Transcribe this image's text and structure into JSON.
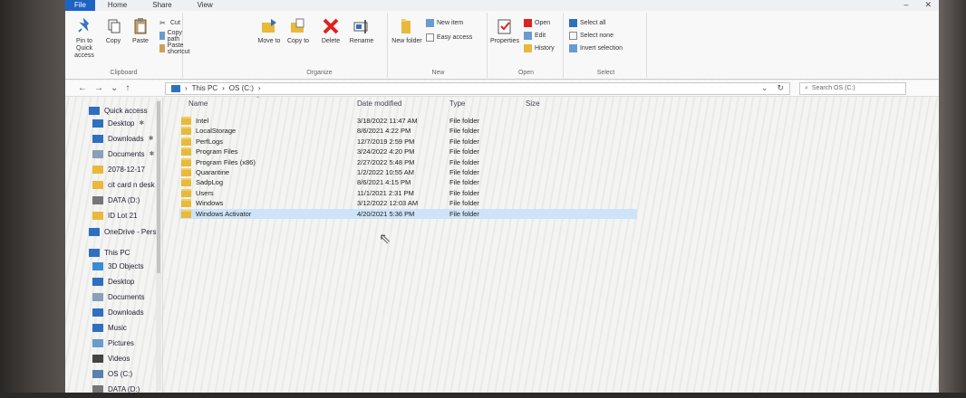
{
  "ribbon_tabs": [
    "File",
    "Home",
    "Share",
    "View"
  ],
  "window_controls": [
    "–",
    "✕"
  ],
  "clipboard": {
    "pin_label": "Pin to Quick access",
    "copy_label": "Copy",
    "paste_label": "Paste",
    "cut_label": "Cut",
    "copy_path_label": "Copy path",
    "paste_shortcut_label": "Paste shortcut",
    "group_label": "Clipboard"
  },
  "organize": {
    "move_to_label": "Move to",
    "copy_to_label": "Copy to",
    "delete_label": "Delete",
    "rename_label": "Rename",
    "group_label": "Organize"
  },
  "new": {
    "new_folder_label": "New folder",
    "new_item_label": "New item",
    "easy_access_label": "Easy access",
    "group_label": "New"
  },
  "open": {
    "properties_label": "Properties",
    "open_label": "Open",
    "edit_label": "Edit",
    "history_label": "History",
    "group_label": "Open"
  },
  "select": {
    "select_all_label": "Select all",
    "select_none_label": "Select none",
    "invert_label": "Invert selection",
    "group_label": "Select"
  },
  "address": {
    "segments": [
      "This PC",
      "OS (C:)"
    ],
    "search_placeholder": "Search OS (C:)"
  },
  "nav_pane": {
    "quick_access_label": "Quick access",
    "items": [
      {
        "label": "Desktop",
        "pinned": true,
        "icon": "desktop-icon",
        "color": "#2f6fc0"
      },
      {
        "label": "Downloads",
        "pinned": true,
        "icon": "download-icon",
        "color": "#2f6fc0"
      },
      {
        "label": "Documents",
        "pinned": true,
        "icon": "document-icon",
        "color": "#8aa0b8"
      },
      {
        "label": "2078-12-17",
        "pinned": false,
        "icon": "folder-icon",
        "color": "#e8b93a"
      },
      {
        "label": "cit card n desk",
        "pinned": false,
        "icon": "folder-icon",
        "color": "#e8b93a"
      },
      {
        "label": "DATA (D:)",
        "pinned": false,
        "icon": "drive-icon",
        "color": "#777777"
      },
      {
        "label": "ID Lot 21",
        "pinned": false,
        "icon": "folder-icon",
        "color": "#e8b93a"
      }
    ],
    "onedrive_label": "OneDrive - Pers",
    "this_pc_label": "This PC",
    "pc_items": [
      {
        "label": "3D Objects",
        "icon": "3d-objects-icon",
        "color": "#3a8ad6"
      },
      {
        "label": "Desktop",
        "icon": "desktop-icon",
        "color": "#2f6fc0"
      },
      {
        "label": "Documents",
        "icon": "document-icon",
        "color": "#8aa0b8"
      },
      {
        "label": "Downloads",
        "icon": "download-icon",
        "color": "#2f6fc0"
      },
      {
        "label": "Music",
        "icon": "music-icon",
        "color": "#2f6fc0"
      },
      {
        "label": "Pictures",
        "icon": "pictures-icon",
        "color": "#6a9bd0"
      },
      {
        "label": "Videos",
        "icon": "videos-icon",
        "color": "#444444"
      },
      {
        "label": "OS (C:)",
        "icon": "drive-icon",
        "color": "#5a7fb0"
      },
      {
        "label": "DATA (D:)",
        "icon": "drive-icon",
        "color": "#777777"
      }
    ]
  },
  "columns": {
    "name": "Name",
    "date": "Date modified",
    "type": "Type",
    "size": "Size"
  },
  "files": [
    {
      "name": "Intel",
      "date": "3/18/2022 11:47 AM",
      "type": "File folder",
      "selected": false
    },
    {
      "name": "LocalStorage",
      "date": "8/6/2021 4:22 PM",
      "type": "File folder",
      "selected": false
    },
    {
      "name": "PerfLogs",
      "date": "12/7/2019 2:59 PM",
      "type": "File folder",
      "selected": false
    },
    {
      "name": "Program Files",
      "date": "3/24/2022 4:20 PM",
      "type": "File folder",
      "selected": false
    },
    {
      "name": "Program Files (x86)",
      "date": "2/27/2022 5:48 PM",
      "type": "File folder",
      "selected": false
    },
    {
      "name": "Quarantine",
      "date": "1/2/2022 10:55 AM",
      "type": "File folder",
      "selected": false
    },
    {
      "name": "SadpLog",
      "date": "8/6/2021 4:15 PM",
      "type": "File folder",
      "selected": false
    },
    {
      "name": "Users",
      "date": "11/1/2021 2:31 PM",
      "type": "File folder",
      "selected": false
    },
    {
      "name": "Windows",
      "date": "3/12/2022 12:03 AM",
      "type": "File folder",
      "selected": false
    },
    {
      "name": "Windows Activator",
      "date": "4/20/2021 5:36 PM",
      "type": "File folder",
      "selected": true
    }
  ]
}
